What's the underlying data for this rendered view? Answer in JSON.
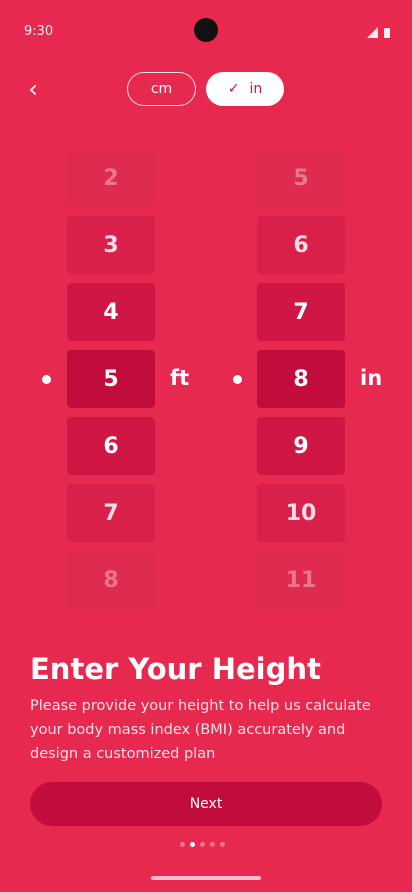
{
  "status": {
    "time": "9:30"
  },
  "nav": {
    "back_icon": "chevron-left-icon",
    "back_glyph": "‹"
  },
  "unit_toggle": {
    "cm_label": "cm",
    "in_label": "in",
    "selected": "in",
    "check_glyph": "✓"
  },
  "picker": {
    "feet": {
      "values": [
        "2",
        "3",
        "4",
        "5",
        "6",
        "7",
        "8"
      ],
      "selected": "5",
      "unit_label": "ft"
    },
    "inches": {
      "values": [
        "5",
        "6",
        "7",
        "8",
        "9",
        "10",
        "11"
      ],
      "selected": "8",
      "unit_label": "in"
    }
  },
  "content": {
    "title": "Enter Your Height",
    "description": "Please provide your height to help us calculate your body mass index (BMI) accurately and design a customized plan"
  },
  "actions": {
    "next_label": "Next"
  },
  "pagination": {
    "total": 5,
    "current": 2
  },
  "colors": {
    "background": "#E8294F",
    "accent_dark": "#C20D3C",
    "text": "#FFFFFF"
  }
}
